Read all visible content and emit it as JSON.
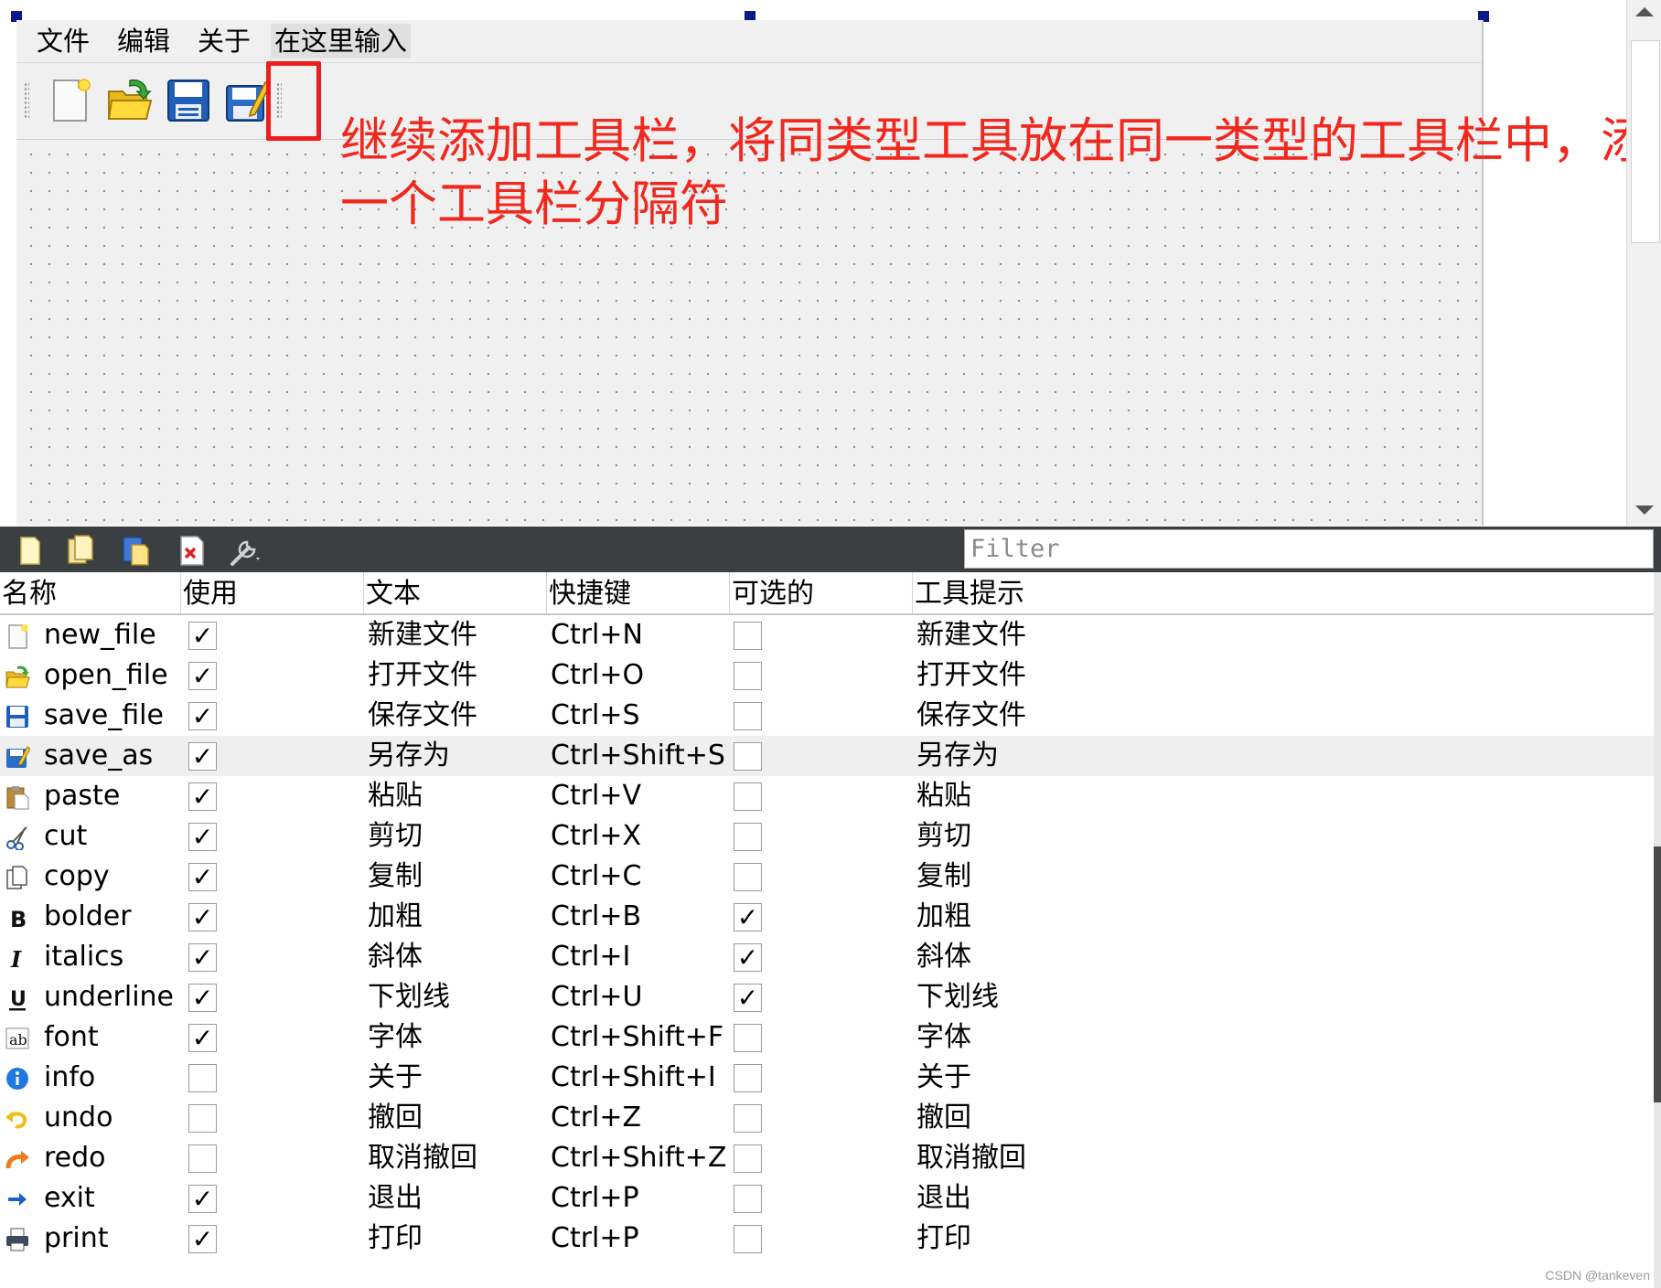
{
  "menubar": {
    "items": [
      "文件",
      "编辑",
      "关于",
      "在这里输入"
    ]
  },
  "toolbar": {
    "icons": [
      "new-file-icon",
      "open-file-icon",
      "save-file-icon",
      "save-as-icon"
    ]
  },
  "annotation": {
    "line1": "继续添加工具栏，将同类型工具放在同一类型的工具栏中，添加",
    "line2": "一个工具栏分隔符",
    "color": "#f0281e"
  },
  "action_editor": {
    "toolbar_icons": [
      "new-action-icon",
      "copy-action-icon",
      "paste-action-icon",
      "delete-action-icon",
      "configure-icon"
    ],
    "filter_placeholder": "Filter",
    "columns": [
      "名称",
      "使用",
      "文本",
      "快捷键",
      "可选的",
      "工具提示"
    ],
    "selected_row": 3,
    "rows": [
      {
        "icon": "new-file-icon",
        "name": "new_file",
        "used": true,
        "text": "新建文件",
        "shortcut": "Ctrl+N",
        "checkable": false,
        "tooltip": "新建文件"
      },
      {
        "icon": "open-file-icon",
        "name": "open_file",
        "used": true,
        "text": "打开文件",
        "shortcut": "Ctrl+O",
        "checkable": false,
        "tooltip": "打开文件"
      },
      {
        "icon": "save-file-icon",
        "name": "save_file",
        "used": true,
        "text": "保存文件",
        "shortcut": "Ctrl+S",
        "checkable": false,
        "tooltip": "保存文件"
      },
      {
        "icon": "save-as-icon",
        "name": "save_as",
        "used": true,
        "text": "另存为",
        "shortcut": "Ctrl+Shift+S",
        "checkable": false,
        "tooltip": "另存为"
      },
      {
        "icon": "paste-icon",
        "name": "paste",
        "used": true,
        "text": "粘贴",
        "shortcut": "Ctrl+V",
        "checkable": false,
        "tooltip": "粘贴"
      },
      {
        "icon": "cut-icon",
        "name": "cut",
        "used": true,
        "text": "剪切",
        "shortcut": "Ctrl+X",
        "checkable": false,
        "tooltip": "剪切"
      },
      {
        "icon": "copy-icon",
        "name": "copy",
        "used": true,
        "text": "复制",
        "shortcut": "Ctrl+C",
        "checkable": false,
        "tooltip": "复制"
      },
      {
        "icon": "bold-icon",
        "name": "bolder",
        "used": true,
        "text": "加粗",
        "shortcut": "Ctrl+B",
        "checkable": true,
        "tooltip": "加粗"
      },
      {
        "icon": "italic-icon",
        "name": "italics",
        "used": true,
        "text": "斜体",
        "shortcut": "Ctrl+I",
        "checkable": true,
        "tooltip": "斜体"
      },
      {
        "icon": "underline-icon",
        "name": "underline",
        "used": true,
        "text": "下划线",
        "shortcut": "Ctrl+U",
        "checkable": true,
        "tooltip": "下划线"
      },
      {
        "icon": "font-icon",
        "name": "font",
        "used": true,
        "text": "字体",
        "shortcut": "Ctrl+Shift+F",
        "checkable": false,
        "tooltip": "字体"
      },
      {
        "icon": "info-icon",
        "name": "info",
        "used": false,
        "text": "关于",
        "shortcut": "Ctrl+Shift+I",
        "checkable": false,
        "tooltip": "关于"
      },
      {
        "icon": "undo-icon",
        "name": "undo",
        "used": false,
        "text": "撤回",
        "shortcut": "Ctrl+Z",
        "checkable": false,
        "tooltip": "撤回"
      },
      {
        "icon": "redo-icon",
        "name": "redo",
        "used": false,
        "text": "取消撤回",
        "shortcut": "Ctrl+Shift+Z",
        "checkable": false,
        "tooltip": "取消撤回"
      },
      {
        "icon": "exit-icon",
        "name": "exit",
        "used": true,
        "text": "退出",
        "shortcut": "Ctrl+P",
        "checkable": false,
        "tooltip": "退出"
      },
      {
        "icon": "print-icon",
        "name": "print",
        "used": true,
        "text": "打印",
        "shortcut": "Ctrl+P",
        "checkable": false,
        "tooltip": "打印"
      }
    ]
  },
  "watermark": "CSDN @tankeven"
}
